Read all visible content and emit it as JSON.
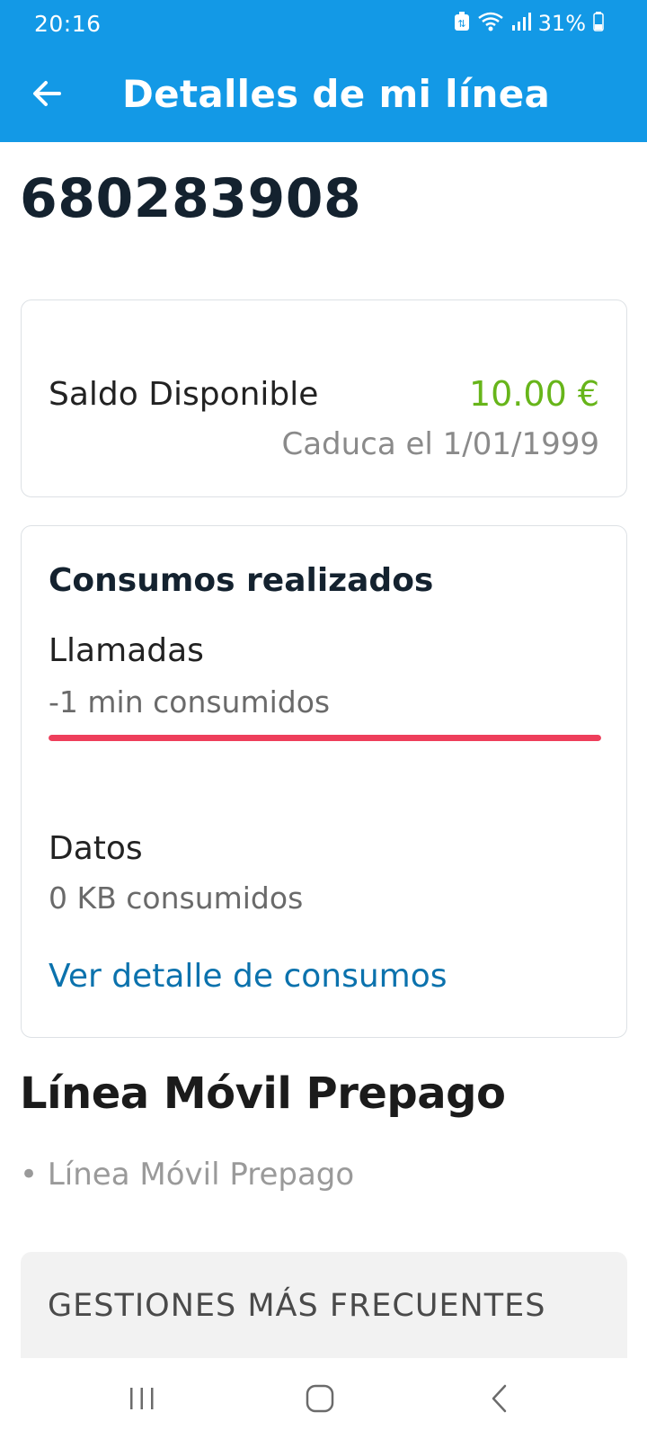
{
  "status_bar": {
    "time": "20:16",
    "battery": "31%"
  },
  "app_bar": {
    "title": "Detalles de mi línea",
    "back_icon": "arrow-left-icon"
  },
  "line": {
    "number": "680283908"
  },
  "balance": {
    "label": "Saldo Disponible",
    "value": "10.00 €",
    "expiry": "Caduca el 1/01/1999"
  },
  "usage": {
    "title": "Consumos realizados",
    "calls_label": "Llamadas",
    "calls_value": "-1 min consumidos",
    "calls_progress": 1.0,
    "data_label": "Datos",
    "data_value": "0 KB consumidos",
    "detail_link": "Ver detalle de consumos"
  },
  "plan": {
    "title": "Línea Móvil Prepago",
    "item": "• Línea Móvil Prepago"
  },
  "gestiones": {
    "title": "GESTIONES MÁS FRECUENTES"
  },
  "colors": {
    "app_bar": "#1399e6",
    "balance_value": "#67b51a",
    "usage_bar": "#ee3e5b",
    "link": "#0b72ad"
  },
  "nav_bar": {
    "recents_icon": "recent-apps-icon",
    "home_icon": "home-icon",
    "back_icon": "back-chevron-icon"
  }
}
